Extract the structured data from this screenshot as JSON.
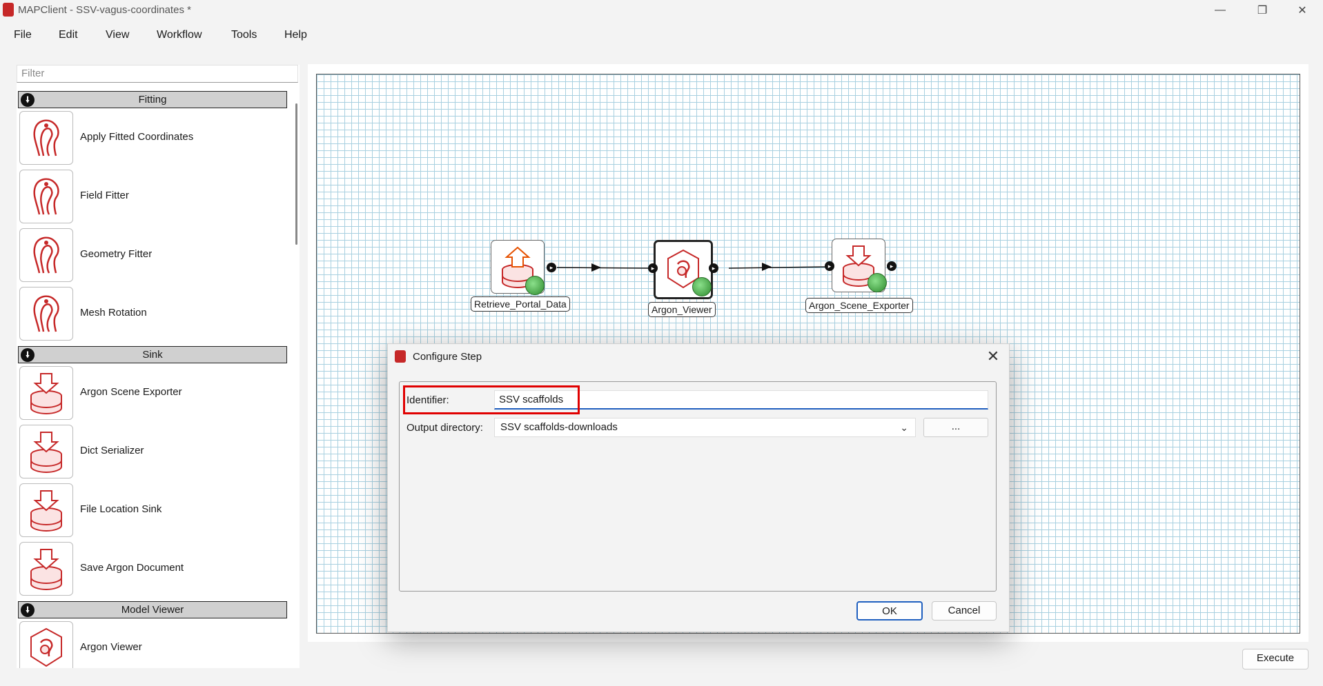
{
  "window": {
    "title": "MAPClient - SSV-vagus-coordinates *"
  },
  "menu": [
    "File",
    "Edit",
    "View",
    "Workflow",
    "Tools",
    "Help"
  ],
  "left_panel": {
    "filter_placeholder": "Filter",
    "categories": [
      {
        "name": "Fitting",
        "items": [
          "Apply Fitted Coordinates",
          "Field Fitter",
          "Geometry Fitter",
          "Mesh Rotation"
        ]
      },
      {
        "name": "Sink",
        "items": [
          "Argon Scene Exporter",
          "Dict Serializer",
          "File Location Sink",
          "Save Argon Document"
        ]
      },
      {
        "name": "Model Viewer",
        "items": [
          "Argon Viewer"
        ]
      }
    ]
  },
  "workflow": {
    "nodes": [
      {
        "label": "Retrieve_Portal_Data",
        "icon": "database-upload-icon"
      },
      {
        "label": "Argon_Viewer",
        "icon": "argon-viewer-icon",
        "selected": true
      },
      {
        "label": "Argon_Scene_Exporter",
        "icon": "database-download-icon"
      }
    ]
  },
  "dialog": {
    "title": "Configure Step",
    "identifier_label": "Identifier:",
    "identifier_value": "SSV scaffolds",
    "output_dir_label": "Output directory:",
    "output_dir_value": "SSV scaffolds-downloads",
    "browse_label": "...",
    "ok_label": "OK",
    "cancel_label": "Cancel"
  },
  "footer": {
    "execute_label": "Execute"
  },
  "colors": {
    "accent": "#1f5fbf",
    "highlight": "#e00000",
    "brand": "#c62828",
    "grid": "#a8d0e0"
  }
}
